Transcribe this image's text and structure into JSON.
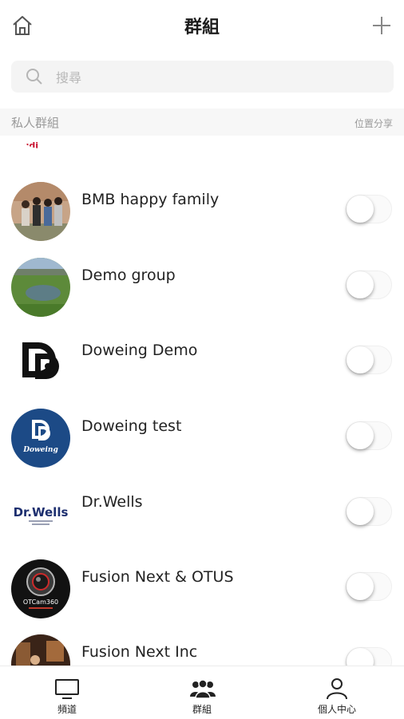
{
  "header": {
    "title": "群組",
    "home_icon": "home-icon",
    "add_icon": "plus-icon"
  },
  "search": {
    "placeholder": "搜尋",
    "value": ""
  },
  "section": {
    "title": "私人群組",
    "right_label": "位置分享"
  },
  "groups": [
    {
      "name": "Audi",
      "avatar": "audi-logo",
      "location_sharing": false
    },
    {
      "name": "BMB happy family",
      "avatar": "family-photo",
      "location_sharing": false
    },
    {
      "name": "Demo group",
      "avatar": "golf-course-photo",
      "location_sharing": false
    },
    {
      "name": "Doweing Demo",
      "avatar": "doweing-logo-black",
      "location_sharing": false
    },
    {
      "name": "Doweing test",
      "avatar": "doweing-logo-blue",
      "avatar_text": "Doweing",
      "location_sharing": false
    },
    {
      "name": "Dr.Wells",
      "avatar": "drwells-logo",
      "avatar_text": "Dr.Wells",
      "location_sharing": false
    },
    {
      "name": "Fusion Next & OTUS",
      "avatar": "otcam-logo",
      "avatar_text": "OTCam360",
      "location_sharing": false
    },
    {
      "name": "Fusion Next Inc",
      "avatar": "event-photo",
      "location_sharing": false
    }
  ],
  "tabs": [
    {
      "label": "頻道",
      "icon": "tv-icon"
    },
    {
      "label": "群組",
      "icon": "group-icon"
    },
    {
      "label": "個人中心",
      "icon": "person-icon"
    }
  ],
  "colors": {
    "background": "#ffffff",
    "search_bg": "#f4f4f4",
    "section_bg": "#f7f7f7",
    "muted_text": "#9a9a9a",
    "doweing_blue": "#1c4a86",
    "audi_red": "#c8102e"
  }
}
